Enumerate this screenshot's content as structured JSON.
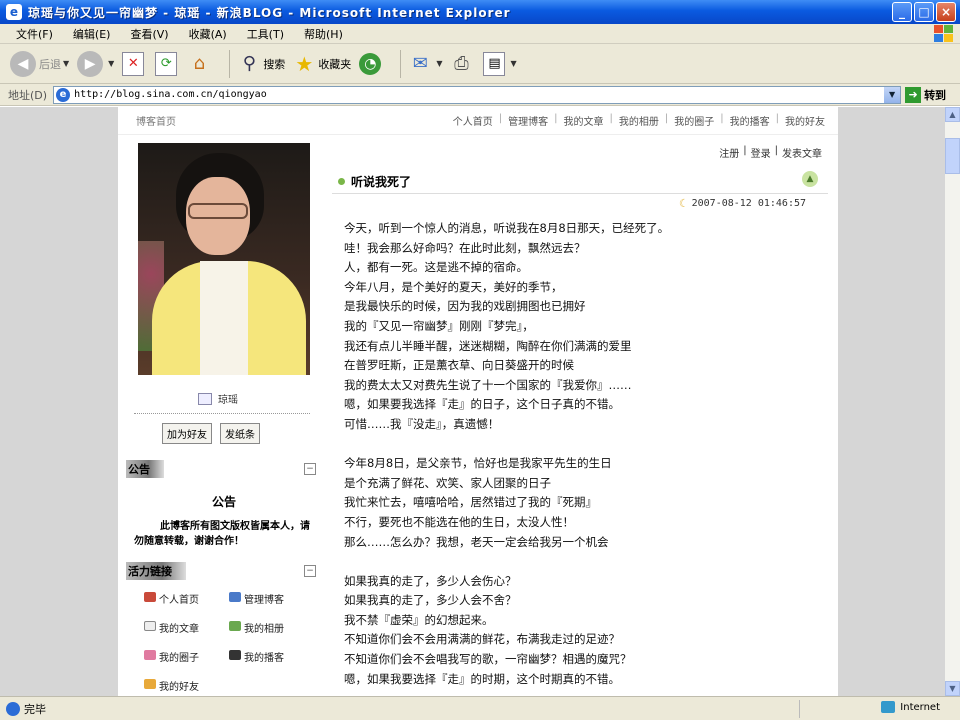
{
  "window": {
    "title": "琼瑶与你又见一帘幽梦 - 琼瑶 - 新浪BLOG - Microsoft Internet Explorer",
    "controls": [
      "_",
      "□",
      "×"
    ]
  },
  "menu": [
    "文件(F)",
    "编辑(E)",
    "查看(V)",
    "收藏(A)",
    "工具(T)",
    "帮助(H)"
  ],
  "toolbar": {
    "back": "后退",
    "search": "搜索",
    "favorites": "收藏夹"
  },
  "address": {
    "label": "地址(D)",
    "url": "http://blog.sina.com.cn/qiongyao",
    "go": "转到"
  },
  "blog": {
    "home": "博客首页",
    "nav": [
      "个人首页",
      "管理博客",
      "我的文章",
      "我的相册",
      "我的圈子",
      "我的播客",
      "我的好友"
    ],
    "user_links": [
      "注册",
      "登录",
      "发表文章"
    ],
    "author_name": "琼瑶",
    "buttons": [
      "加为好友",
      "发纸条"
    ],
    "notice": {
      "header": "公告",
      "title": "公告",
      "body": "此博客所有图文版权皆属本人，请勿随意转载，谢谢合作！"
    },
    "links_section": {
      "header": "活力链接",
      "items": [
        "个人首页",
        "管理博客",
        "我的文章",
        "我的相册",
        "我的圈子",
        "我的播客",
        "我的好友"
      ]
    },
    "post": {
      "title": "听说我死了",
      "time": "2007-08-12 01:46:57",
      "lines": [
        "今天，听到一个惊人的消息，听说我在8月8日那天，已经死了。",
        "哇！我会那么好命吗？在此时此刻，飘然远去？",
        "人，都有一死。这是逃不掉的宿命。",
        "今年八月，是个美好的夏天，美好的季节，",
        "是我最快乐的时候，因为我的戏剧拥图也已拥好",
        "我的『又见一帘幽梦』刚刚『梦完』，",
        "我还有点儿半睡半醒，迷迷糊糊，陶醉在你们满满的爱里",
        "在普罗旺斯，正是薰衣草、向日葵盛开的时候",
        "我的费太太又对费先生说了十一个国家的『我爱你』……",
        "嗯，如果要我选择『走』的日子，这个日子真的不错。",
        "可惜……我『没走』，真遗憾！",
        "",
        "今年8月8日，是父亲节，恰好也是我家平先生的生日",
        "是个充满了鲜花、欢笑、家人团聚的日子",
        "我忙来忙去，嘻嘻哈哈，居然错过了我的『死期』",
        "不行，要死也不能选在他的生日，太没人性！",
        "那么……怎么办？我想，老天一定会给我另一个机会",
        "",
        "如果我真的走了，多少人会伤心？",
        "如果我真的走了，多少人会不舍？",
        "我不禁『虚荣』的幻想起来。",
        "不知道你们会不会用满满的鲜花，布满我走过的足迹？",
        "不知道你们会不会唱我写的歌，一帘幽梦？相遇的魔咒？",
        "嗯，如果我要选择『走』的时期，这个时期真的不错。"
      ]
    }
  },
  "status": {
    "text": "完毕",
    "zone": "Internet"
  },
  "colors": {
    "titlebar": "#0a5ae0",
    "chrome": "#ece9d8",
    "page_bg": "#d6d6d6"
  }
}
